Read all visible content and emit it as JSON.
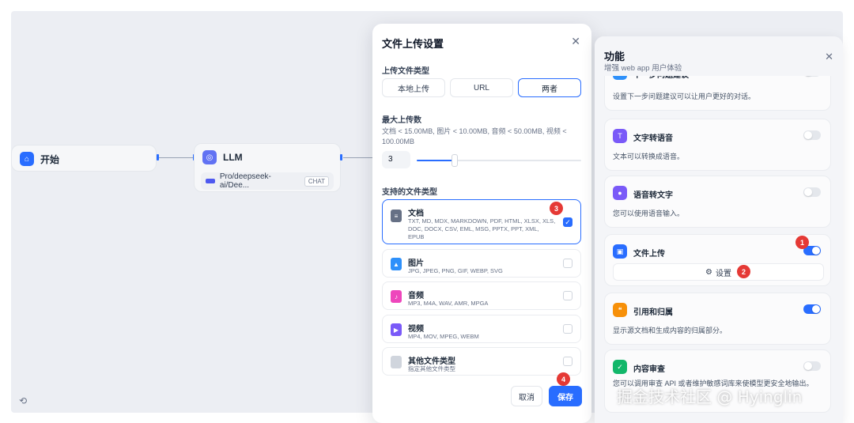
{
  "canvas": {
    "start_node": {
      "label": "开始"
    },
    "llm_node": {
      "label": "LLM",
      "model": "Pro/deepseek-ai/Dee...",
      "model_tag": "CHAT"
    }
  },
  "upload_dialog": {
    "title": "文件上传设置",
    "upload_type_label": "上传文件类型",
    "upload_options": [
      "本地上传",
      "URL",
      "两者"
    ],
    "selected_option": "两者",
    "max_uploads_label": "最大上传数",
    "limits_text": "文档 < 15.00MB, 图片 < 10.00MB, 音频 < 50.00MB, 视频 < 100.00MB",
    "max_uploads_value": "3",
    "max_uploads_fraction": 0.23,
    "supported_types_label": "支持的文件类型",
    "file_types": [
      {
        "name": "文档",
        "extensions": "TXT, MD, MDX, MARKDOWN, PDF, HTML, XLSX, XLS, DOC, DOCX, CSV, EML, MSG, PPTX, PPT, XML, EPUB",
        "checked": true,
        "color": "#667085",
        "icon": "document-icon"
      },
      {
        "name": "图片",
        "extensions": "JPG, JPEG, PNG, GIF, WEBP, SVG",
        "checked": false,
        "color": "#2e90fa",
        "icon": "image-icon"
      },
      {
        "name": "音频",
        "extensions": "MP3, M4A, WAV, AMR, MPGA",
        "checked": false,
        "color": "#ee46bc",
        "icon": "audio-icon"
      },
      {
        "name": "视频",
        "extensions": "MP4, MOV, MPEG, WEBM",
        "checked": false,
        "color": "#7a5af8",
        "icon": "video-icon"
      },
      {
        "name": "其他文件类型",
        "extensions": "指定其他文件类型",
        "checked": false,
        "color": "#d0d5dd",
        "icon": "file-icon"
      }
    ],
    "cancel_label": "取消",
    "save_label": "保存"
  },
  "features_panel": {
    "title": "功能",
    "subtitle": "增强 web app 用户体验",
    "features": [
      {
        "name": "下一步问题建议",
        "description": "设置下一步问题建议可以让用户更好的对话。",
        "enabled": false,
        "color": "#2e90fa",
        "icon": "suggestion-icon"
      },
      {
        "name": "文字转语音",
        "description": "文本可以转换成语音。",
        "enabled": false,
        "color": "#7a5af8",
        "icon": "text-to-speech-icon"
      },
      {
        "name": "语音转文字",
        "description": "您可以使用语音输入。",
        "enabled": false,
        "color": "#7a5af8",
        "icon": "microphone-icon"
      },
      {
        "name": "文件上传",
        "description": "",
        "enabled": true,
        "color": "#296dff",
        "icon": "folder-upload-icon",
        "settings_label": "设置"
      },
      {
        "name": "引用和归属",
        "description": "显示源文档和生成内容的归属部分。",
        "enabled": true,
        "color": "#f79009",
        "icon": "citation-icon"
      },
      {
        "name": "内容审查",
        "description": "您可以调用审查 API 或者维护敏感词库来使模型更安全地输出。",
        "enabled": false,
        "color": "#12b76a",
        "icon": "moderation-icon"
      }
    ]
  },
  "badges": [
    "1",
    "2",
    "3",
    "4"
  ],
  "watermark": "掘金技术社区 @ Hyinglin"
}
